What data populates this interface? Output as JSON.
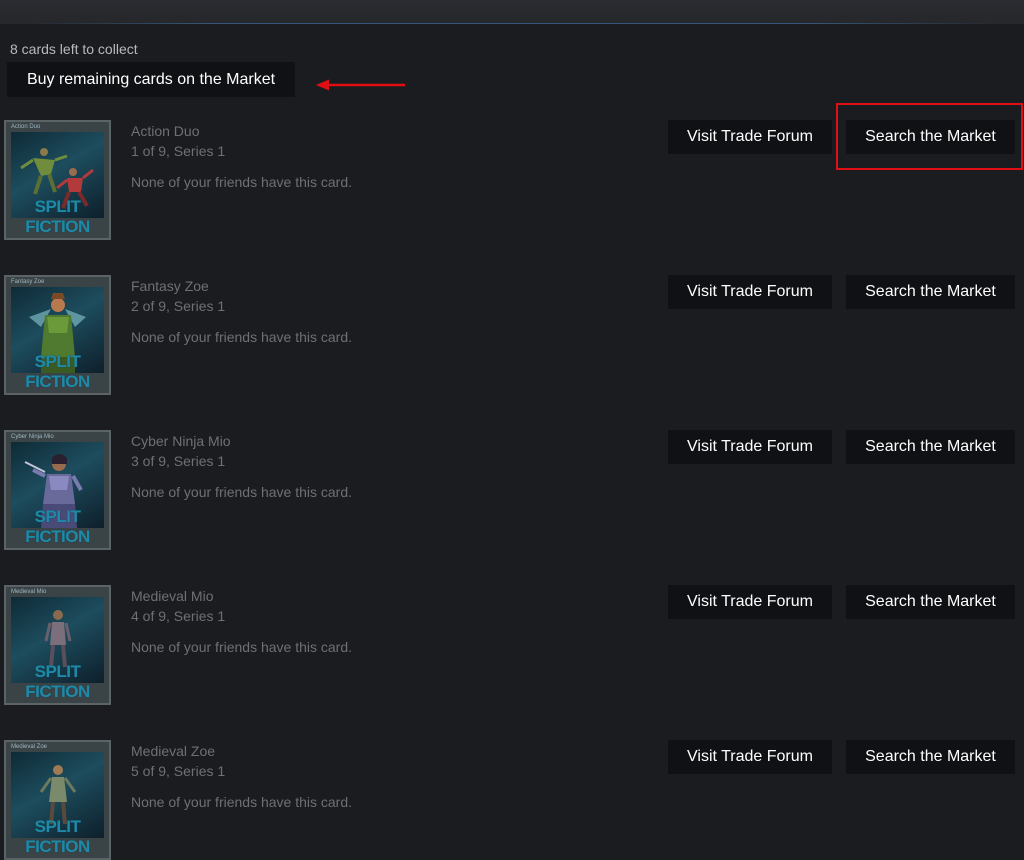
{
  "header": {
    "cards_left": "8 cards left to collect",
    "buy_remaining_label": "Buy remaining cards on the Market"
  },
  "annotations": {
    "arrow_color": "#e10f13",
    "highlight_color": "#e10f13"
  },
  "cards": [
    {
      "thumb_label": "Action Duo",
      "logo_text": "SPLIT FICTION",
      "name": "Action Duo",
      "series": "1 of 9, Series 1",
      "friends": "None of your friends have this card.",
      "forum_label": "Visit Trade Forum",
      "market_label": "Search the Market"
    },
    {
      "thumb_label": "Fantasy Zoe",
      "logo_text": "SPLIT FICTION",
      "name": "Fantasy Zoe",
      "series": "2 of 9, Series 1",
      "friends": "None of your friends have this card.",
      "forum_label": "Visit Trade Forum",
      "market_label": "Search the Market"
    },
    {
      "thumb_label": "Cyber Ninja Mio",
      "logo_text": "SPLIT FICTION",
      "name": "Cyber Ninja Mio",
      "series": "3 of 9, Series 1",
      "friends": "None of your friends have this card.",
      "forum_label": "Visit Trade Forum",
      "market_label": "Search the Market"
    },
    {
      "thumb_label": "Medieval Mio",
      "logo_text": "SPLIT FICTION",
      "name": "Medieval Mio",
      "series": "4 of 9, Series 1",
      "friends": "None of your friends have this card.",
      "forum_label": "Visit Trade Forum",
      "market_label": "Search the Market"
    },
    {
      "thumb_label": "Medieval Zoe",
      "logo_text": "SPLIT FICTION",
      "name": "Medieval Zoe",
      "series": "5 of 9, Series 1",
      "friends": "None of your friends have this card.",
      "forum_label": "Visit Trade Forum",
      "market_label": "Search the Market"
    }
  ]
}
